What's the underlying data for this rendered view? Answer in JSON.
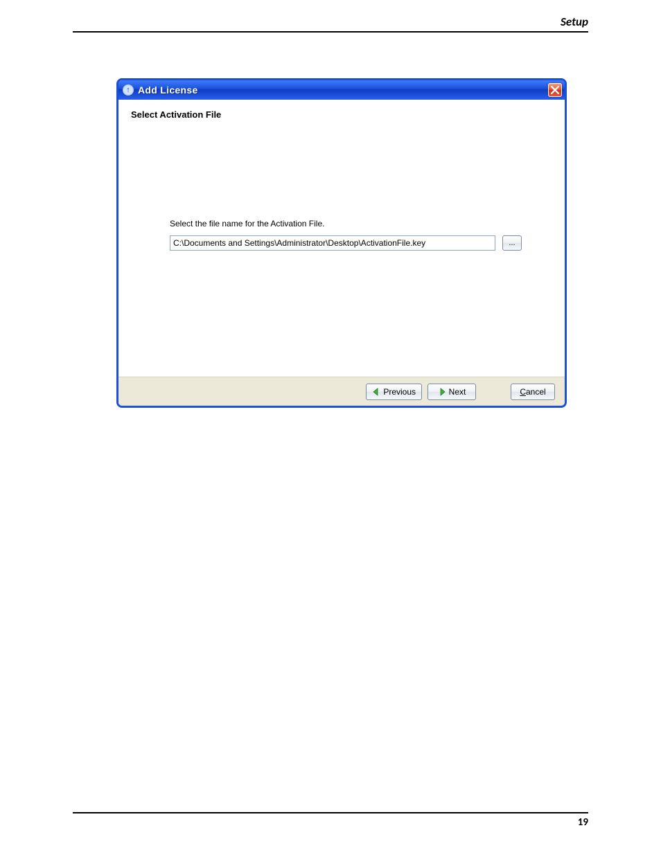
{
  "page": {
    "header_label": "Setup",
    "page_number": "19"
  },
  "dialog": {
    "title": "Add License",
    "heading": "Select Activation File",
    "instruction": "Select the file name for the Activation File.",
    "path_value": "C:\\Documents and Settings\\Administrator\\Desktop\\ActivationFile.key",
    "browse_label": "...",
    "buttons": {
      "previous": "Previous",
      "next": "Next",
      "cancel": "Cancel"
    }
  }
}
